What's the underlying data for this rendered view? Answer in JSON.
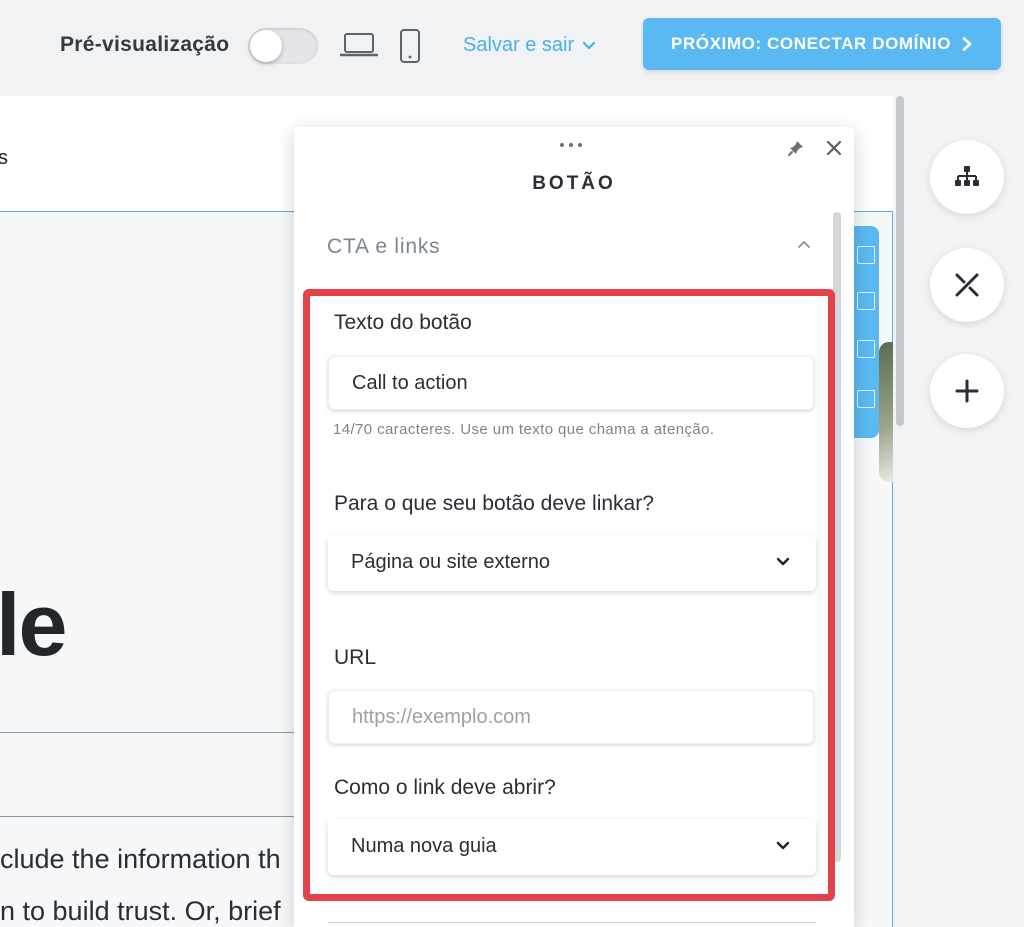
{
  "topbar": {
    "preview_label": "Pré-visualização",
    "preview_on": false,
    "save_exit_label": "Salvar e sair",
    "next_button_label": "PRÓXIMO: CONECTAR DOMÍNIO",
    "accent_color": "#5ab9f2"
  },
  "canvas": {
    "nav_fragment": "s",
    "hero_fragment": "le",
    "body_line_1": "clude the information th",
    "body_line_2": "n to build trust. Or, brief"
  },
  "panel": {
    "title": "BOTÃO",
    "section_label": "CTA e links",
    "button_text_label": "Texto do botão",
    "button_text_value": "Call to action",
    "button_text_hint": "14/70 caracteres. Use um texto que chama a atenção.",
    "link_target_label": "Para o que seu botão deve linkar?",
    "link_target_value": "Página ou site externo",
    "url_label": "URL",
    "url_placeholder": "https://exemplo.com",
    "url_value": "",
    "open_mode_label": "Como o link deve abrir?",
    "open_mode_value": "Numa nova guia"
  },
  "highlight_color": "#e3424a",
  "icons": [
    "laptop-icon",
    "phone-icon",
    "chevron-down-icon",
    "chevron-right-icon",
    "pin-icon",
    "close-icon",
    "sitemap-icon",
    "tools-icon",
    "plus-icon"
  ]
}
